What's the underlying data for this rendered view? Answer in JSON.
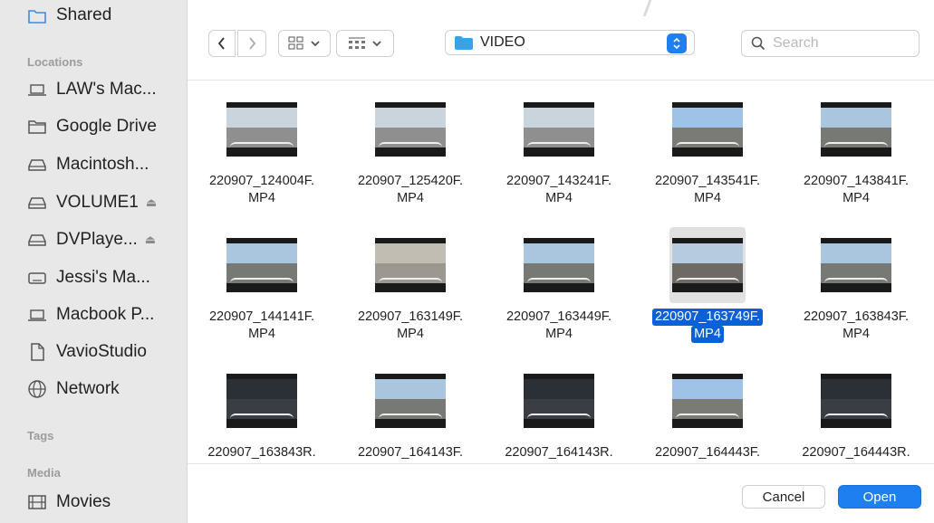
{
  "sidebar": {
    "top_item": {
      "label": "Shared",
      "icon": "shared-folder-icon"
    },
    "locations_header": "Locations",
    "locations": [
      {
        "label": "LAW's Mac...",
        "icon": "laptop-icon",
        "eject": false
      },
      {
        "label": "Google Drive",
        "icon": "folder-icon",
        "eject": false
      },
      {
        "label": "Macintosh...",
        "icon": "drive-icon",
        "eject": false
      },
      {
        "label": "VOLUME1",
        "icon": "drive-icon",
        "eject": true
      },
      {
        "label": "DVPlaye...",
        "icon": "drive-icon",
        "eject": true
      },
      {
        "label": "Jessi's Ma...",
        "icon": "display-icon",
        "eject": false
      },
      {
        "label": "Macbook P...",
        "icon": "laptop-icon",
        "eject": false
      },
      {
        "label": "VavioStudio",
        "icon": "document-icon",
        "eject": false
      },
      {
        "label": "Network",
        "icon": "network-globe-icon",
        "eject": false
      }
    ],
    "tags_header": "Tags",
    "media_header": "Media",
    "media": [
      {
        "label": "Movies",
        "icon": "film-icon"
      }
    ],
    "eject_glyph": "⏏"
  },
  "toolbar": {
    "back_icon": "chevron-left-icon",
    "forward_icon": "chevron-right-icon",
    "path_folder": "VIDEO",
    "search_placeholder": "Search",
    "search_value": ""
  },
  "files": [
    {
      "line1": "220907_124004F.",
      "line2": "MP4",
      "scene": "garage"
    },
    {
      "line1": "220907_125420F.",
      "line2": "MP4",
      "scene": "garage"
    },
    {
      "line1": "220907_143241F.",
      "line2": "MP4",
      "scene": "garage"
    },
    {
      "line1": "220907_143541F.",
      "line2": "MP4",
      "scene": "street"
    },
    {
      "line1": "220907_143841F.",
      "line2": "MP4",
      "scene": "road"
    },
    {
      "line1": "220907_144141F.",
      "line2": "MP4",
      "scene": "road"
    },
    {
      "line1": "220907_163149F.",
      "line2": "MP4",
      "scene": "garage-door"
    },
    {
      "line1": "220907_163449F.",
      "line2": "MP4",
      "scene": "road"
    },
    {
      "line1": "220907_163749F.",
      "line2": "MP4",
      "scene": "highway",
      "selected": true
    },
    {
      "line1": "220907_163843F.",
      "line2": "MP4",
      "scene": "road"
    },
    {
      "line1": "220907_163843R.",
      "line2": "",
      "scene": "interior"
    },
    {
      "line1": "220907_164143F.",
      "line2": "",
      "scene": "road"
    },
    {
      "line1": "220907_164143R.",
      "line2": "",
      "scene": "interior"
    },
    {
      "line1": "220907_164443F.",
      "line2": "",
      "scene": "street"
    },
    {
      "line1": "220907_164443R.",
      "line2": "",
      "scene": "interior"
    }
  ],
  "buttons": {
    "cancel": "Cancel",
    "open": "Open"
  },
  "colors": {
    "accent": "#1e7ff0",
    "selection": "#0a60d6",
    "sidebar_bg": "#e9e8e8"
  }
}
